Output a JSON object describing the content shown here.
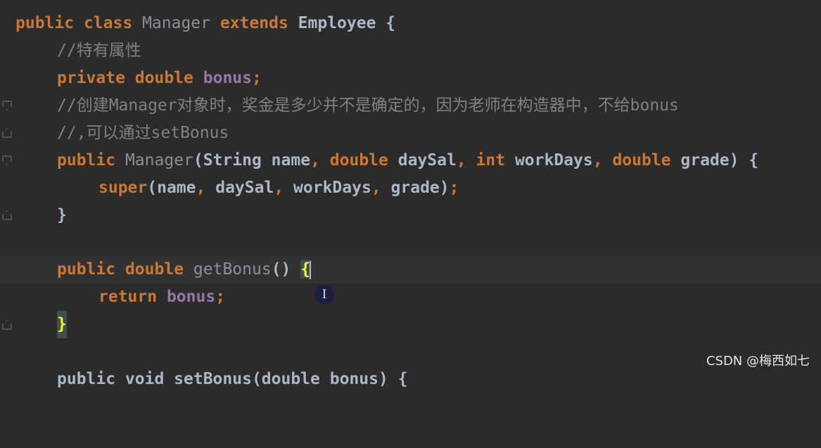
{
  "lines": [
    {
      "parts": [
        "public",
        "class",
        "Manager",
        "extends",
        "Employee {"
      ]
    },
    {
      "text": "//特有属性"
    },
    {
      "parts": [
        "private",
        "double",
        "bonus",
        ";"
      ]
    },
    {
      "text": "//创建Manager对象时，奖金是多少并不是确定的，因为老师在构造器中，不给bonus"
    },
    {
      "text": "//,可以通过setBonus"
    },
    {
      "parts": [
        "public",
        "Manager",
        "(String name",
        ",",
        "double",
        "daySal",
        ",",
        "int",
        "workDays",
        ",",
        "double",
        "grade) {"
      ]
    },
    {
      "parts": [
        "super",
        "(name",
        ",",
        "daySal",
        ",",
        "workDays",
        ",",
        "grade)",
        ";"
      ]
    },
    {
      "text": "}"
    },
    {
      "parts": [
        "public",
        "double",
        "getBonus",
        "() ",
        "{"
      ]
    },
    {
      "parts": [
        "return",
        "bonus",
        ";"
      ]
    },
    {
      "text": "}"
    },
    {
      "text": "public void setBonus(double bonus) {"
    }
  ],
  "cursor_icon": "text-cursor-icon",
  "watermark": "CSDN @梅西如七"
}
